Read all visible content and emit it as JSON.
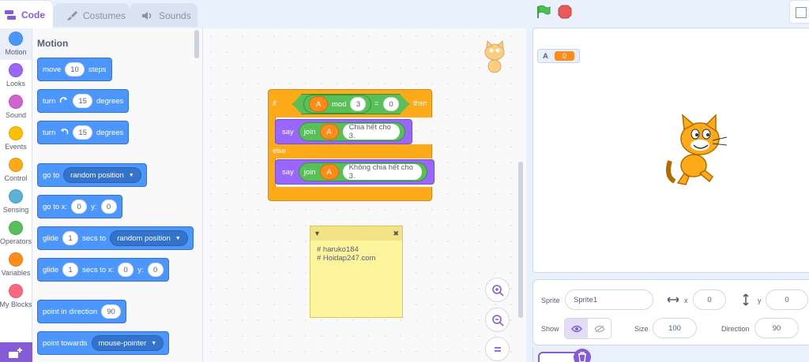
{
  "tabs": {
    "code": "Code",
    "costumes": "Costumes",
    "sounds": "Sounds"
  },
  "categories": [
    {
      "label": "Motion",
      "color": "#4c97ff"
    },
    {
      "label": "Looks",
      "color": "#9966ff"
    },
    {
      "label": "Sound",
      "color": "#cf63cf"
    },
    {
      "label": "Events",
      "color": "#ffbf00"
    },
    {
      "label": "Control",
      "color": "#ffab19"
    },
    {
      "label": "Sensing",
      "color": "#5cb1d6"
    },
    {
      "label": "Operators",
      "color": "#59c059"
    },
    {
      "label": "Variables",
      "color": "#ff8c1a"
    },
    {
      "label": "My Blocks",
      "color": "#ff6680"
    }
  ],
  "palette": {
    "title": "Motion",
    "move": {
      "prefix": "move",
      "steps": "10",
      "suffix": "steps"
    },
    "turn_right": {
      "prefix": "turn",
      "degrees": "15",
      "suffix": "degrees"
    },
    "turn_left": {
      "prefix": "turn",
      "degrees": "15",
      "suffix": "degrees"
    },
    "goto": {
      "prefix": "go to",
      "target": "random position"
    },
    "goto_xy": {
      "prefix": "go to x:",
      "x": "0",
      "ylabel": "y:",
      "y": "0"
    },
    "glide_to": {
      "prefix": "glide",
      "secs": "1",
      "mid": "secs to",
      "target": "random position"
    },
    "glide_xy": {
      "prefix": "glide",
      "secs": "1",
      "mid": "secs to x:",
      "x": "0",
      "ylabel": "y:",
      "y": "0"
    },
    "point_dir": {
      "prefix": "point in direction",
      "value": "90"
    },
    "point_towards": {
      "prefix": "point towards",
      "target": "mouse-pointer"
    }
  },
  "script": {
    "if_label": "if",
    "then_label": "then",
    "else_label": "else",
    "var_a": "A",
    "mod_label": "mod",
    "mod_value": "3",
    "equals": "=",
    "compare_value": "0",
    "say_label": "say",
    "join_label": "join",
    "say1_text": "Chia hết cho 3.",
    "say2_text": "Không chia hết cho 3."
  },
  "note": {
    "lines": [
      "# haruko184",
      "# Hoidap247.com"
    ]
  },
  "stage": {
    "monitor_name": "A",
    "monitor_value": "0"
  },
  "sprite_info": {
    "sprite_label": "Sprite",
    "sprite_name": "Sprite1",
    "x_label": "x",
    "x_value": "0",
    "y_label": "y",
    "y_value": "0",
    "show_label": "Show",
    "size_label": "Size",
    "size_value": "100",
    "direction_label": "Direction",
    "direction_value": "90"
  },
  "colors": {
    "accent": "#855cd6",
    "motion": "#4c97ff",
    "control": "#ffab19",
    "looks": "#9966ff",
    "operators": "#59c059",
    "variables": "#ff8c1a"
  }
}
